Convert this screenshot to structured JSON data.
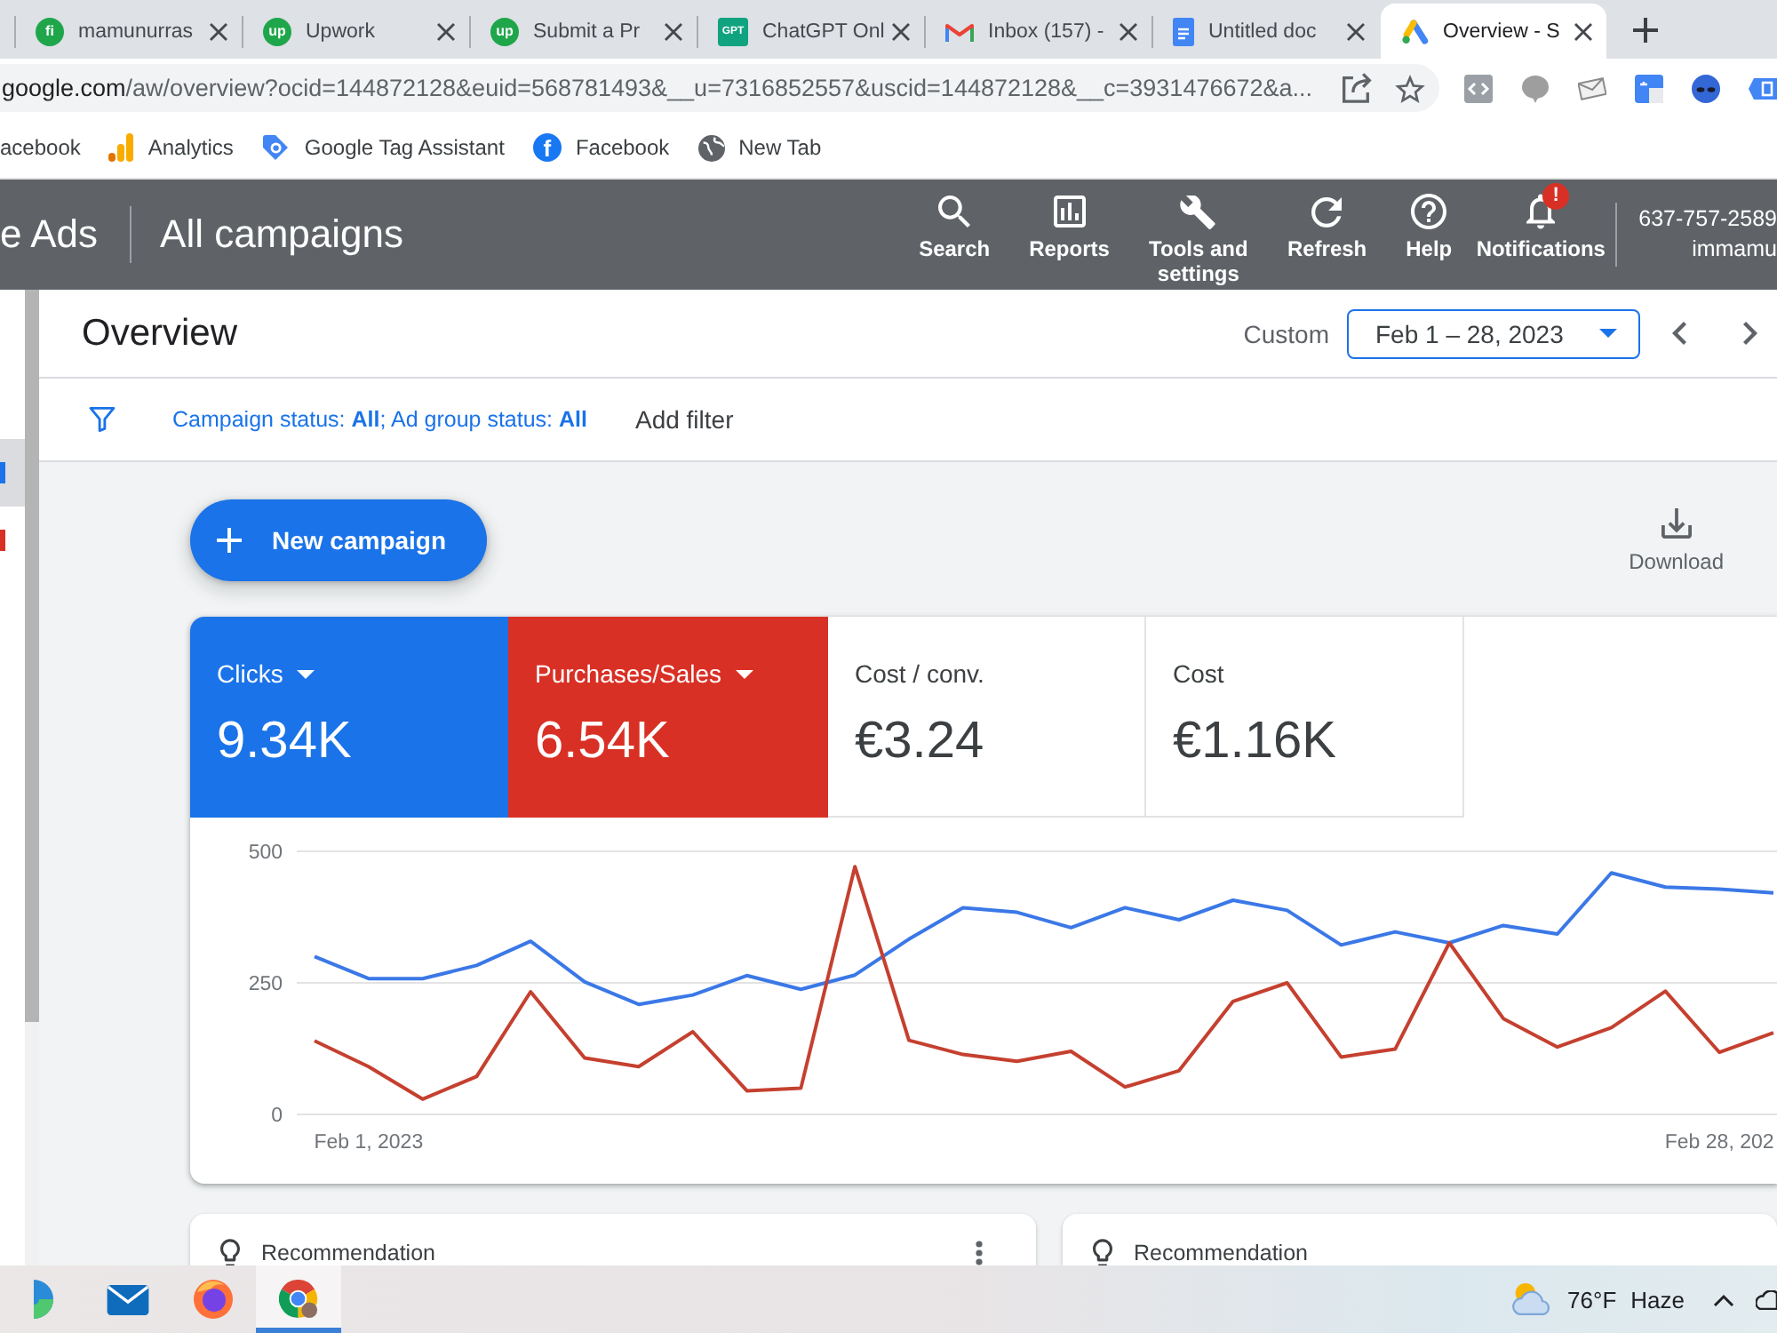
{
  "browser": {
    "tabs": [
      {
        "title": "mamunurras",
        "icon": {
          "kind": "round",
          "text": "fi"
        },
        "selected": false
      },
      {
        "title": "Upwork",
        "icon": {
          "kind": "round",
          "text": "up"
        },
        "selected": false
      },
      {
        "title": "Submit a Pr",
        "icon": {
          "kind": "round",
          "text": "up"
        },
        "selected": false
      },
      {
        "title": "ChatGPT Onl",
        "icon": {
          "kind": "square",
          "text": "GPT"
        },
        "selected": false
      },
      {
        "title": "Inbox (157) -",
        "icon": {
          "kind": "mail"
        },
        "selected": false
      },
      {
        "title": "Untitled doc",
        "icon": {
          "kind": "doc"
        },
        "selected": false
      },
      {
        "title": "Overview - S",
        "icon": {
          "kind": "mark"
        },
        "selected": true
      }
    ],
    "address": {
      "host": "google.com",
      "path": "/aw/overview?ocid=144872128&euid=568781493&__u=7316852557&uscid=144872128&__c=3931476672&a..."
    },
    "bookmarks": [
      {
        "label": "acebook",
        "kind": "none"
      },
      {
        "label": "Analytics",
        "kind": "bars"
      },
      {
        "label": "Google Tag Assistant",
        "kind": "tag"
      },
      {
        "label": "Facebook",
        "kind": "round",
        "icon_text": "f"
      },
      {
        "label": "New Tab",
        "kind": "globe"
      }
    ]
  },
  "header": {
    "product": "e Ads",
    "title": "All campaigns",
    "actions": [
      {
        "label": "Search",
        "kind": "search"
      },
      {
        "label": "Reports",
        "kind": "reports"
      },
      {
        "label": "Tools and settings",
        "kind": "tools"
      },
      {
        "label": "Refresh",
        "kind": "refresh"
      },
      {
        "label": "Help",
        "kind": "help"
      },
      {
        "label": "Notifications",
        "kind": "bell",
        "badge": "!"
      }
    ],
    "account": {
      "id": "637-757-2589",
      "name": "immamu"
    }
  },
  "sidebar": {
    "items": [
      {
        "selected": true,
        "color": "#1a73e8"
      },
      {
        "selected": false,
        "color": "#d93025"
      }
    ]
  },
  "overview": {
    "title": "Overview",
    "date_label": "Custom",
    "date_range": "Feb 1 – 28, 2023"
  },
  "filter": {
    "summary": "Campaign status: **All**; Ad group status: **All**",
    "add_label": "Add filter"
  },
  "actions": {
    "new_campaign": "New campaign",
    "download": "Download"
  },
  "scorecards": [
    {
      "label": "Clicks",
      "value": "9.34K",
      "selected": true,
      "color": "#1a73e8"
    },
    {
      "label": "Purchases/Sales",
      "value": "6.54K",
      "selected": true,
      "color": "#d93025"
    },
    {
      "label": "Cost / conv.",
      "value": "€3.24",
      "selected": false
    },
    {
      "label": "Cost",
      "value": "€1.16K",
      "selected": false
    }
  ],
  "chart": {
    "chart_data": {
      "type": "line",
      "categories": [
        null,
        "Feb 1, 2023",
        null,
        null,
        null,
        null,
        null,
        null,
        null,
        null,
        null,
        null,
        null,
        null,
        null,
        null,
        null,
        null,
        null,
        null,
        null,
        null,
        null,
        null,
        null,
        null,
        "Feb 28, 202",
        null
      ],
      "ylim": [
        0,
        500
      ],
      "yticks": [
        0,
        250,
        500
      ],
      "series": [
        {
          "color": "#3b78e7",
          "values": [
            300,
            258,
            258,
            283,
            329,
            252,
            209,
            227,
            264,
            238,
            265,
            333,
            393,
            384,
            355,
            393,
            370,
            407,
            388,
            322,
            347,
            326,
            359,
            343,
            459,
            432,
            428,
            421
          ]
        },
        {
          "color": "#c5402f",
          "values": [
            140,
            91,
            29,
            72,
            233,
            107,
            91,
            157,
            45,
            50,
            471,
            141,
            114,
            101,
            120,
            52,
            83,
            215,
            250,
            109,
            124,
            326,
            182,
            128,
            165,
            234,
            118,
            155
          ]
        }
      ]
    }
  },
  "recommendations": [
    {
      "label": "Recommendation",
      "menu": true
    },
    {
      "label": "Recommendation",
      "menu": false
    }
  ],
  "taskbar": {
    "apps": [
      {
        "kind": "swirl",
        "selected": false
      },
      {
        "kind": "mail",
        "selected": false
      },
      {
        "kind": "fox",
        "selected": false
      },
      {
        "kind": "ring",
        "selected": true
      }
    ],
    "weather": {
      "temp": "76°F",
      "condition": "Haze"
    }
  }
}
